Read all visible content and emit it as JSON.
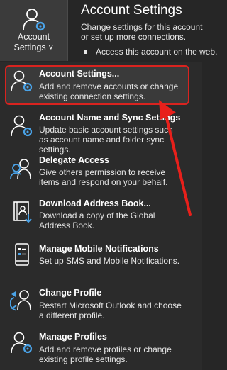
{
  "header": {
    "button_line1": "Account",
    "button_line2": "Settings ˅",
    "title": "Account Settings",
    "description": "Change settings for this account or set up more connections.",
    "bullet": "Access this account on the web."
  },
  "menu": {
    "items": [
      {
        "icon": "person-gear-icon",
        "title": "Account Settings...",
        "desc": "Add and remove accounts or change existing connection settings."
      },
      {
        "icon": "person-gear-icon",
        "title": "Account Name and Sync Settings",
        "desc": "Update basic account settings such as account name and folder sync settings."
      },
      {
        "icon": "delegate-people-icon",
        "title": "Delegate Access",
        "desc": "Give others permission to receive items and respond on your behalf."
      },
      {
        "icon": "address-book-download-icon",
        "title": "Download Address Book...",
        "desc": "Download a copy of the Global Address Book."
      },
      {
        "icon": "mobile-notifications-icon",
        "title": "Manage Mobile Notifications",
        "desc": "Set up SMS and Mobile Notifications."
      },
      {
        "icon": "change-profile-icon",
        "title": "Change Profile",
        "desc": "Restart Microsoft Outlook and choose a different profile."
      },
      {
        "icon": "manage-profiles-icon",
        "title": "Manage Profiles",
        "desc": "Add and remove profiles or change existing profile settings."
      }
    ]
  },
  "colors": {
    "highlight_border": "#d9231f",
    "arrow": "#e8201b",
    "icon_blue": "#4aa3e8"
  }
}
